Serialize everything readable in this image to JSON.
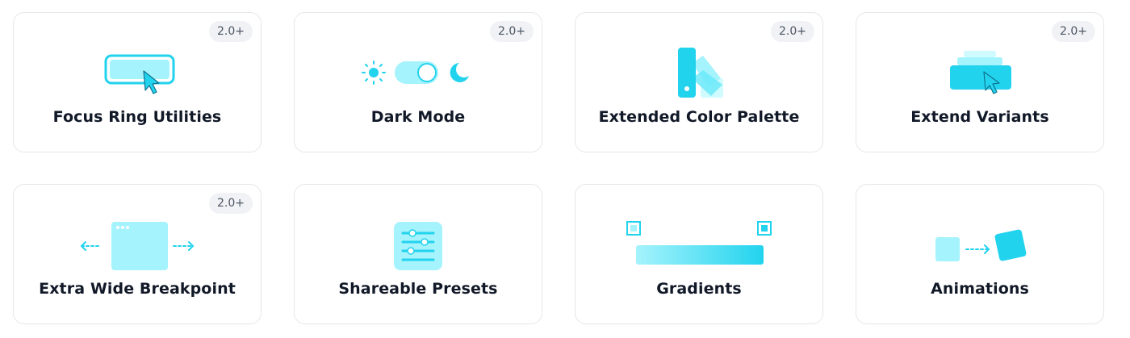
{
  "colors": {
    "accent": "#22d3ee",
    "accent_light": "#a5f3fc",
    "accent_dark": "#06b6d4",
    "border": "#e5e7eb",
    "badge_bg": "#f1f2f5",
    "text": "#111827"
  },
  "cards": [
    {
      "title": "Focus Ring Utilities",
      "badge": "2.0+",
      "icon": "focus-ring-cursor-icon"
    },
    {
      "title": "Dark Mode",
      "badge": "2.0+",
      "icon": "sun-toggle-moon-icon"
    },
    {
      "title": "Extended Color Palette",
      "badge": "2.0+",
      "icon": "color-swatch-icon"
    },
    {
      "title": "Extend Variants",
      "badge": "2.0+",
      "icon": "stacked-button-cursor-icon"
    },
    {
      "title": "Extra Wide Breakpoint",
      "badge": "2.0+",
      "icon": "browser-window-arrows-icon"
    },
    {
      "title": "Shareable Presets",
      "icon": "sliders-icon"
    },
    {
      "title": "Gradients",
      "icon": "gradient-bar-icon"
    },
    {
      "title": "Animations",
      "icon": "rotating-square-icon"
    }
  ]
}
